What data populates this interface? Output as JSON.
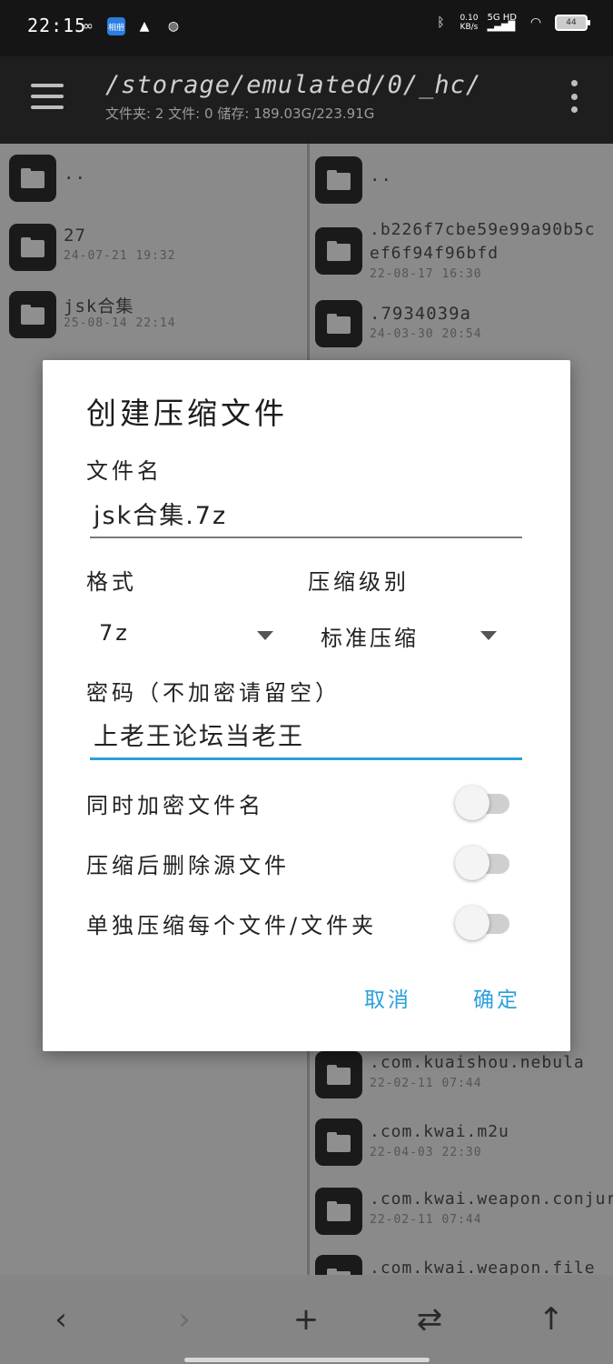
{
  "status_bar": {
    "time": "22:15",
    "blue_badge_text": "相册",
    "net_speed_value": "0.10",
    "net_speed_unit": "KB/s",
    "network": "5G HD",
    "battery": "44"
  },
  "header": {
    "path": "/storage/emulated/0/_hc/",
    "info": "文件夹: 2  文件: 0  储存: 189.03G/223.91G"
  },
  "left_pane": [
    {
      "name": "..",
      "date": ""
    },
    {
      "name": "27",
      "date": "24-07-21 19:32"
    },
    {
      "name": "jsk合集",
      "date": "25-08-14 22:14"
    }
  ],
  "right_pane_top": [
    {
      "name": "..",
      "date": ""
    },
    {
      "name": ".b226f7cbe59e99a90b5c",
      "name2": "ef6f94f96bfd",
      "date": "22-08-17 16:30"
    },
    {
      "name": ".7934039a",
      "date": "24-03-30 20:54"
    }
  ],
  "right_pane_bottom": [
    {
      "name": ".com.kuaishou.nebula",
      "date": "22-02-11 07:44"
    },
    {
      "name": ".com.kwai.m2u",
      "date": "22-04-03 22:30"
    },
    {
      "name": ".com.kwai.weapon.conjure",
      "date": "22-02-11 07:44"
    },
    {
      "name": ".com.kwai.weapon.file",
      "date": ""
    }
  ],
  "dialog": {
    "title": "创建压缩文件",
    "filename_label": "文件名",
    "filename_value": "jsk合集.7z",
    "format_label": "格式",
    "format_value": "7z",
    "level_label": "压缩级别",
    "level_value": "标准压缩",
    "password_label": "密码（不加密请留空）",
    "password_value": "上老王论坛当老王",
    "toggles": [
      {
        "label": "同时加密文件名",
        "on": false
      },
      {
        "label": "压缩后删除源文件",
        "on": false
      },
      {
        "label": "单独压缩每个文件/文件夹",
        "on": false
      }
    ],
    "cancel_label": "取消",
    "ok_label": "确定",
    "accent_color": "#2aa0dc"
  },
  "bottom_nav": {
    "back": "‹",
    "forward": "›",
    "add": "+",
    "swap": "⇄",
    "up": "↑"
  }
}
